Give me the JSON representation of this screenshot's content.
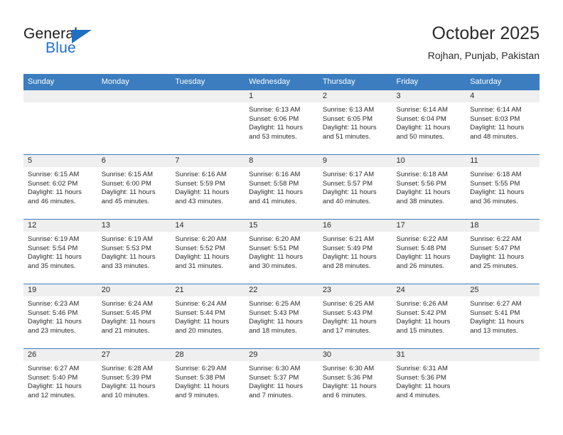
{
  "brand": {
    "name_top": "General",
    "name_bottom": "Blue",
    "accent_color": "#1f6fc4"
  },
  "header": {
    "title": "October 2025",
    "subtitle": "Rojhan, Punjab, Pakistan"
  },
  "calendar": {
    "header_bg": "#3b7dbf",
    "daynum_bg": "#efeff0",
    "weekday_labels": [
      "Sunday",
      "Monday",
      "Tuesday",
      "Wednesday",
      "Thursday",
      "Friday",
      "Saturday"
    ],
    "weeks": [
      [
        {
          "day": "",
          "lines": []
        },
        {
          "day": "",
          "lines": []
        },
        {
          "day": "",
          "lines": []
        },
        {
          "day": "1",
          "lines": [
            "Sunrise: 6:13 AM",
            "Sunset: 6:06 PM",
            "Daylight: 11 hours",
            "and 53 minutes."
          ]
        },
        {
          "day": "2",
          "lines": [
            "Sunrise: 6:13 AM",
            "Sunset: 6:05 PM",
            "Daylight: 11 hours",
            "and 51 minutes."
          ]
        },
        {
          "day": "3",
          "lines": [
            "Sunrise: 6:14 AM",
            "Sunset: 6:04 PM",
            "Daylight: 11 hours",
            "and 50 minutes."
          ]
        },
        {
          "day": "4",
          "lines": [
            "Sunrise: 6:14 AM",
            "Sunset: 6:03 PM",
            "Daylight: 11 hours",
            "and 48 minutes."
          ]
        }
      ],
      [
        {
          "day": "5",
          "lines": [
            "Sunrise: 6:15 AM",
            "Sunset: 6:02 PM",
            "Daylight: 11 hours",
            "and 46 minutes."
          ]
        },
        {
          "day": "6",
          "lines": [
            "Sunrise: 6:15 AM",
            "Sunset: 6:00 PM",
            "Daylight: 11 hours",
            "and 45 minutes."
          ]
        },
        {
          "day": "7",
          "lines": [
            "Sunrise: 6:16 AM",
            "Sunset: 5:59 PM",
            "Daylight: 11 hours",
            "and 43 minutes."
          ]
        },
        {
          "day": "8",
          "lines": [
            "Sunrise: 6:16 AM",
            "Sunset: 5:58 PM",
            "Daylight: 11 hours",
            "and 41 minutes."
          ]
        },
        {
          "day": "9",
          "lines": [
            "Sunrise: 6:17 AM",
            "Sunset: 5:57 PM",
            "Daylight: 11 hours",
            "and 40 minutes."
          ]
        },
        {
          "day": "10",
          "lines": [
            "Sunrise: 6:18 AM",
            "Sunset: 5:56 PM",
            "Daylight: 11 hours",
            "and 38 minutes."
          ]
        },
        {
          "day": "11",
          "lines": [
            "Sunrise: 6:18 AM",
            "Sunset: 5:55 PM",
            "Daylight: 11 hours",
            "and 36 minutes."
          ]
        }
      ],
      [
        {
          "day": "12",
          "lines": [
            "Sunrise: 6:19 AM",
            "Sunset: 5:54 PM",
            "Daylight: 11 hours",
            "and 35 minutes."
          ]
        },
        {
          "day": "13",
          "lines": [
            "Sunrise: 6:19 AM",
            "Sunset: 5:53 PM",
            "Daylight: 11 hours",
            "and 33 minutes."
          ]
        },
        {
          "day": "14",
          "lines": [
            "Sunrise: 6:20 AM",
            "Sunset: 5:52 PM",
            "Daylight: 11 hours",
            "and 31 minutes."
          ]
        },
        {
          "day": "15",
          "lines": [
            "Sunrise: 6:20 AM",
            "Sunset: 5:51 PM",
            "Daylight: 11 hours",
            "and 30 minutes."
          ]
        },
        {
          "day": "16",
          "lines": [
            "Sunrise: 6:21 AM",
            "Sunset: 5:49 PM",
            "Daylight: 11 hours",
            "and 28 minutes."
          ]
        },
        {
          "day": "17",
          "lines": [
            "Sunrise: 6:22 AM",
            "Sunset: 5:48 PM",
            "Daylight: 11 hours",
            "and 26 minutes."
          ]
        },
        {
          "day": "18",
          "lines": [
            "Sunrise: 6:22 AM",
            "Sunset: 5:47 PM",
            "Daylight: 11 hours",
            "and 25 minutes."
          ]
        }
      ],
      [
        {
          "day": "19",
          "lines": [
            "Sunrise: 6:23 AM",
            "Sunset: 5:46 PM",
            "Daylight: 11 hours",
            "and 23 minutes."
          ]
        },
        {
          "day": "20",
          "lines": [
            "Sunrise: 6:24 AM",
            "Sunset: 5:45 PM",
            "Daylight: 11 hours",
            "and 21 minutes."
          ]
        },
        {
          "day": "21",
          "lines": [
            "Sunrise: 6:24 AM",
            "Sunset: 5:44 PM",
            "Daylight: 11 hours",
            "and 20 minutes."
          ]
        },
        {
          "day": "22",
          "lines": [
            "Sunrise: 6:25 AM",
            "Sunset: 5:43 PM",
            "Daylight: 11 hours",
            "and 18 minutes."
          ]
        },
        {
          "day": "23",
          "lines": [
            "Sunrise: 6:25 AM",
            "Sunset: 5:43 PM",
            "Daylight: 11 hours",
            "and 17 minutes."
          ]
        },
        {
          "day": "24",
          "lines": [
            "Sunrise: 6:26 AM",
            "Sunset: 5:42 PM",
            "Daylight: 11 hours",
            "and 15 minutes."
          ]
        },
        {
          "day": "25",
          "lines": [
            "Sunrise: 6:27 AM",
            "Sunset: 5:41 PM",
            "Daylight: 11 hours",
            "and 13 minutes."
          ]
        }
      ],
      [
        {
          "day": "26",
          "lines": [
            "Sunrise: 6:27 AM",
            "Sunset: 5:40 PM",
            "Daylight: 11 hours",
            "and 12 minutes."
          ]
        },
        {
          "day": "27",
          "lines": [
            "Sunrise: 6:28 AM",
            "Sunset: 5:39 PM",
            "Daylight: 11 hours",
            "and 10 minutes."
          ]
        },
        {
          "day": "28",
          "lines": [
            "Sunrise: 6:29 AM",
            "Sunset: 5:38 PM",
            "Daylight: 11 hours",
            "and 9 minutes."
          ]
        },
        {
          "day": "29",
          "lines": [
            "Sunrise: 6:30 AM",
            "Sunset: 5:37 PM",
            "Daylight: 11 hours",
            "and 7 minutes."
          ]
        },
        {
          "day": "30",
          "lines": [
            "Sunrise: 6:30 AM",
            "Sunset: 5:36 PM",
            "Daylight: 11 hours",
            "and 6 minutes."
          ]
        },
        {
          "day": "31",
          "lines": [
            "Sunrise: 6:31 AM",
            "Sunset: 5:36 PM",
            "Daylight: 11 hours",
            "and 4 minutes."
          ]
        },
        {
          "day": "",
          "lines": []
        }
      ]
    ]
  }
}
